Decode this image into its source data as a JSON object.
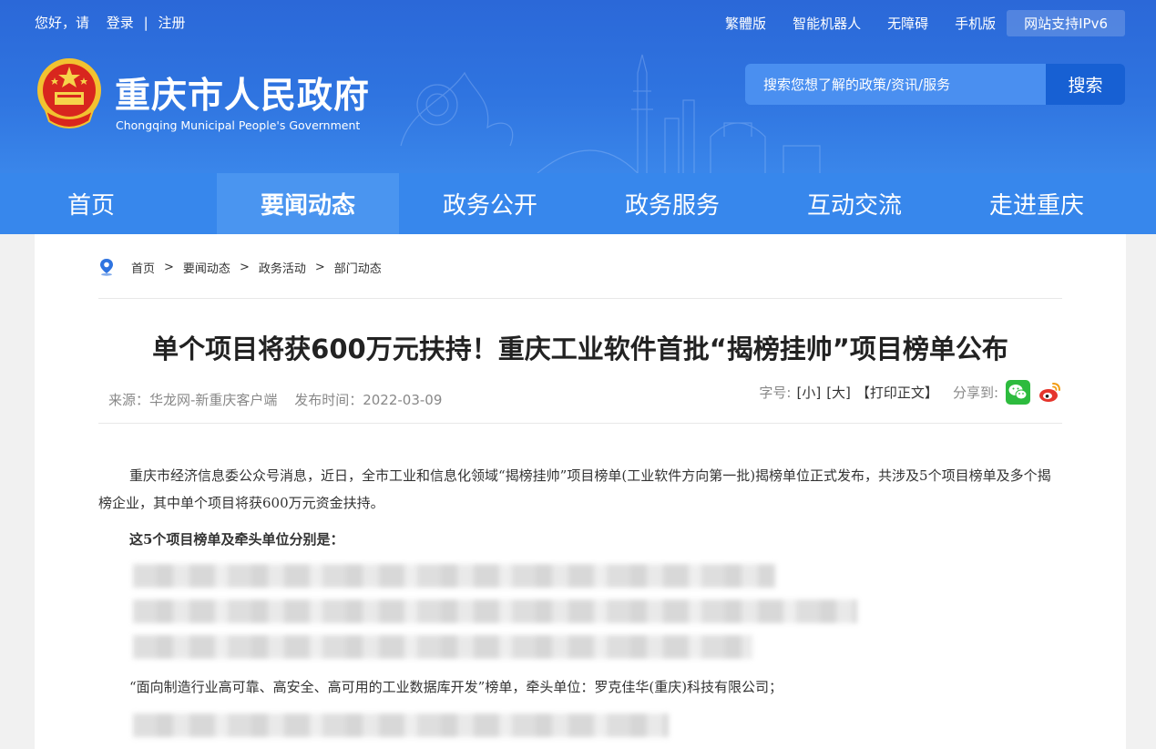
{
  "topbar": {
    "greeting": "您好，请",
    "login": "登录",
    "separator": "|",
    "register": "注册",
    "links": [
      "繁體版",
      "智能机器人",
      "无障碍",
      "手机版"
    ],
    "ipv6": "网站支持IPv6"
  },
  "site": {
    "title": "重庆市人民政府",
    "subtitle": "Chongqing Municipal People's Government"
  },
  "search": {
    "placeholder": "搜索您想了解的政策/资讯/服务",
    "button": "搜索"
  },
  "nav": {
    "items": [
      "首页",
      "要闻动态",
      "政务公开",
      "政务服务",
      "互动交流",
      "走进重庆"
    ],
    "active_index": 1
  },
  "breadcrumb": {
    "items": [
      "首页",
      "要闻动态",
      "政务活动",
      "部门动态"
    ],
    "separator": ">"
  },
  "article": {
    "title": "单个项目将获600万元扶持！重庆工业软件首批“揭榜挂帅”项目榜单公布",
    "source": "来源：华龙网-新重庆客户端",
    "publish_time": "发布时间：2022-03-09",
    "font_size_label": "字号:",
    "font_small": "[小]",
    "font_large": "[大]",
    "print": "【打印正文】",
    "share_label": "分享到:",
    "paragraph1": "重庆市经济信息委公众号消息，近日，全市工业和信息化领域“揭榜挂帅”项目榜单(工业软件方向第一批)揭榜单位正式发布，共涉及5个项目榜单及多个揭榜企业，其中单个项目将获600万元资金扶持。",
    "bold_line": "这5个项目榜单及牵头单位分别是：",
    "visible_item": "“面向制造行业高可靠、高安全、高可用的工业数据库开发”榜单，牵头单位：罗克佳华(重庆)科技有限公司；"
  },
  "colors": {
    "header_blue": "#2f74e0",
    "nav_blue": "#3787ec",
    "nav_active": "#4a95f0",
    "search_button": "#1760d3",
    "wechat_green": "#2dbb3e",
    "weibo_red": "#e5352c"
  },
  "icons": [
    "national-emblem-icon",
    "location-pin-icon",
    "wechat-icon",
    "weibo-icon"
  ]
}
